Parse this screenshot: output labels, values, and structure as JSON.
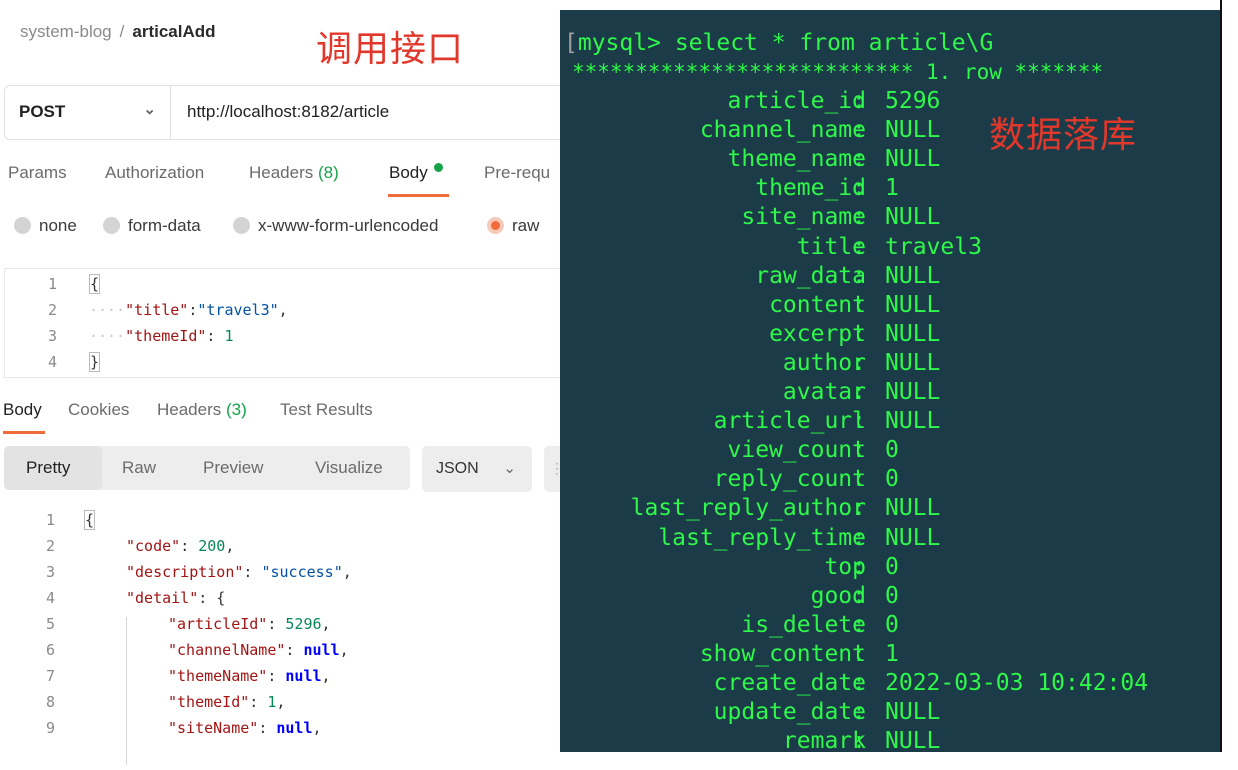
{
  "left": {
    "breadcrumb": {
      "collection": "system-blog",
      "separator": "/",
      "request": "articalAdd"
    },
    "annotation": "调用接口",
    "request": {
      "method": "POST",
      "url": "http://localhost:8182/article"
    },
    "tabs": [
      {
        "label": "Params"
      },
      {
        "label": "Authorization"
      },
      {
        "label": "Headers",
        "count": "(8)"
      },
      {
        "label": "Body",
        "active": true
      },
      {
        "label": "Pre-requ"
      }
    ],
    "body_types": [
      "none",
      "form-data",
      "x-www-form-urlencoded",
      "raw"
    ],
    "selected_body_type": "raw",
    "request_body": {
      "line_numbers": [
        "1",
        "2",
        "3",
        "4"
      ],
      "open": "{",
      "close": "}",
      "title_key": "\"title\"",
      "title_val": "\"travel3\"",
      "theme_key": "\"themeId\"",
      "theme_val": "1"
    },
    "response_tabs": [
      {
        "label": "Body",
        "active": true
      },
      {
        "label": "Cookies"
      },
      {
        "label": "Headers",
        "count": "(3)"
      },
      {
        "label": "Test Results"
      }
    ],
    "view_modes": [
      "Pretty",
      "Raw",
      "Preview",
      "Visualize"
    ],
    "format": "JSON",
    "response": {
      "line_numbers": [
        "1",
        "2",
        "3",
        "4",
        "5",
        "6",
        "7",
        "8",
        "9"
      ],
      "open": "{",
      "code_key": "\"code\"",
      "code_val": "200",
      "desc_key": "\"description\"",
      "desc_val": "\"success\"",
      "detail_key": "\"detail\"",
      "article_id_key": "\"articleId\"",
      "article_id_val": "5296",
      "channel_key": "\"channelName\"",
      "channel_val": "null",
      "theme_name_key": "\"themeName\"",
      "theme_name_val": "null",
      "theme_id_key": "\"themeId\"",
      "theme_id_val": "1",
      "site_key": "\"siteName\"",
      "site_val": "null"
    }
  },
  "terminal": {
    "prompt": "mysql>",
    "command": "select * from article\\G",
    "row_header": "*************************** 1. row *******",
    "annotation": "数据落库",
    "rows": [
      {
        "field": "article_id",
        "value": "5296"
      },
      {
        "field": "channel_name",
        "value": "NULL"
      },
      {
        "field": "theme_name",
        "value": "NULL"
      },
      {
        "field": "theme_id",
        "value": "1"
      },
      {
        "field": "site_name",
        "value": "NULL"
      },
      {
        "field": "title",
        "value": "travel3"
      },
      {
        "field": "raw_data",
        "value": "NULL"
      },
      {
        "field": "content",
        "value": "NULL"
      },
      {
        "field": "excerpt",
        "value": "NULL"
      },
      {
        "field": "author",
        "value": "NULL"
      },
      {
        "field": "avatar",
        "value": "NULL"
      },
      {
        "field": "article_url",
        "value": "NULL"
      },
      {
        "field": "view_count",
        "value": "0"
      },
      {
        "field": "reply_count",
        "value": "0"
      },
      {
        "field": "last_reply_author",
        "value": "NULL"
      },
      {
        "field": "last_reply_time",
        "value": "NULL"
      },
      {
        "field": "top",
        "value": "0"
      },
      {
        "field": "good",
        "value": "0"
      },
      {
        "field": "is_delete",
        "value": "0"
      },
      {
        "field": "show_content",
        "value": "1"
      },
      {
        "field": "create_date",
        "value": "2022-03-03 10:42:04"
      },
      {
        "field": "update_date",
        "value": "NULL"
      },
      {
        "field": "remark",
        "value": "NULL"
      }
    ]
  },
  "colors": {
    "accent": "#f26b3a",
    "terminal_bg": "#1b3b48",
    "terminal_text": "#2ef84a",
    "annotation": "#e2372b",
    "success_green": "#16a34a"
  }
}
